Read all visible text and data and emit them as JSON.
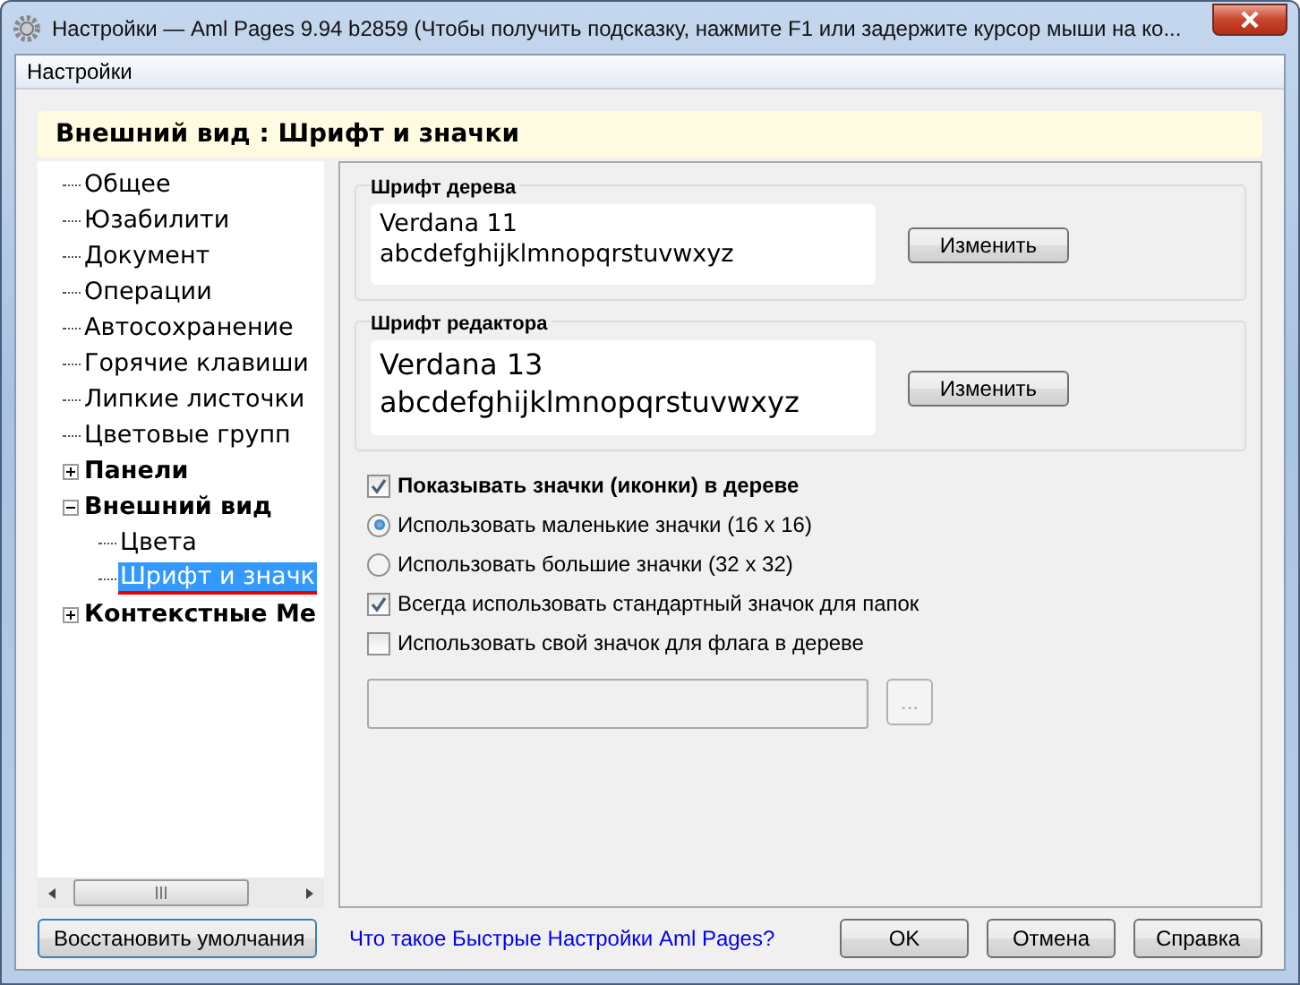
{
  "window": {
    "title": "Настройки — Aml Pages 9.94 b2859 (Чтобы получить подсказку, нажмите F1 или задержите курсор мыши на ко..."
  },
  "menu": [
    "Настройки"
  ],
  "header": "Внешний вид : Шрифт и значки",
  "tree": [
    {
      "label": "Общее",
      "kind": "leaf",
      "selected": false
    },
    {
      "label": "Юзабилити",
      "kind": "leaf",
      "selected": false
    },
    {
      "label": "Документ",
      "kind": "leaf",
      "selected": false
    },
    {
      "label": "Операции",
      "kind": "leaf",
      "selected": false
    },
    {
      "label": "Автосохранение",
      "kind": "leaf",
      "selected": false
    },
    {
      "label": "Горячие клавиши",
      "kind": "leaf",
      "selected": false
    },
    {
      "label": "Липкие листочки",
      "kind": "leaf",
      "selected": false
    },
    {
      "label": "Цветовые групп",
      "kind": "leaf",
      "selected": false
    },
    {
      "label": "Панели",
      "kind": "group",
      "expanded": false,
      "selected": false
    },
    {
      "label": "Внешний вид",
      "kind": "group",
      "expanded": true,
      "selected": false,
      "children": [
        {
          "label": "Цвета",
          "kind": "leaf",
          "selected": false
        },
        {
          "label": "Шрифт и значк",
          "kind": "leaf",
          "selected": true
        }
      ]
    },
    {
      "label": "Контекстные Ме",
      "kind": "group",
      "expanded": false,
      "selected": false
    }
  ],
  "font_groups": [
    {
      "title": "Шрифт дерева",
      "name": "Verdana 11",
      "sample": "abcdefghijklmnopqrstuvwxyz",
      "button": "Изменить"
    },
    {
      "title": "Шрифт редактора",
      "name": "Verdana 13",
      "sample": "abcdefghijklmnopqrstuvwxyz",
      "button": "Изменить"
    }
  ],
  "options": [
    {
      "kind": "checkbox",
      "label": "Показывать значки (иконки) в дереве",
      "bold": true,
      "checked": true
    },
    {
      "kind": "radio",
      "label": "Использовать маленькие значки (16 x 16)",
      "bold": false,
      "checked": true
    },
    {
      "kind": "radio",
      "label": "Использовать большие значки (32 x 32)",
      "bold": false,
      "checked": false
    },
    {
      "kind": "checkbox",
      "label": "Всегда использовать стандартный значок для папок",
      "bold": false,
      "checked": true
    },
    {
      "kind": "checkbox",
      "label": "Использовать свой значок для флага в дереве",
      "bold": false,
      "checked": false
    }
  ],
  "icon_path": {
    "disabled": true,
    "browse_label": "..."
  },
  "footer": {
    "restore": "Восстановить умолчания",
    "link": "Что такое Быстрые Настройки Aml Pages?",
    "buttons": [
      "OK",
      "Отмена",
      "Справка"
    ]
  }
}
